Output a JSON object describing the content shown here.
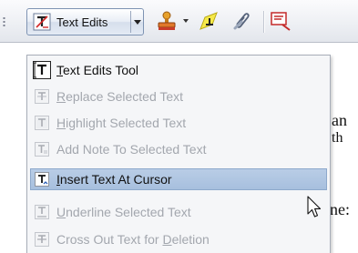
{
  "toolbar": {
    "text_edits_button": {
      "label": "Text Edits",
      "icon": "text-edits-icon"
    },
    "tools": [
      {
        "name": "stamp-tool",
        "icon": "stamp-icon"
      },
      {
        "name": "highlight-tool",
        "icon": "highlighter-icon"
      },
      {
        "name": "attach-tool",
        "icon": "paperclip-icon"
      },
      {
        "name": "comment-tool",
        "icon": "comment-tool-icon"
      }
    ]
  },
  "menu": {
    "items": [
      {
        "pre": "",
        "mnemonic": "T",
        "post": "ext Edits Tool",
        "enabled": true,
        "icon": "text-edits-tool-icon"
      },
      {
        "pre": "",
        "mnemonic": "R",
        "post": "eplace Selected Text",
        "enabled": false,
        "icon": "replace-text-icon"
      },
      {
        "pre": "",
        "mnemonic": "H",
        "post": "ighlight Selected Text",
        "enabled": false,
        "icon": "highlight-text-icon"
      },
      {
        "pre": "Add Note To Selected Text",
        "mnemonic": "",
        "post": "",
        "enabled": false,
        "icon": "add-note-icon"
      },
      {
        "pre": "",
        "mnemonic": "I",
        "post": "nsert Text At Cursor",
        "enabled": true,
        "highlighted": true,
        "icon": "insert-text-icon"
      },
      {
        "pre": "",
        "mnemonic": "U",
        "post": "nderline Selected Text",
        "enabled": false,
        "icon": "underline-text-icon"
      },
      {
        "pre": "Cross Out Text for ",
        "mnemonic": "D",
        "post": "eletion",
        "enabled": false,
        "icon": "cross-out-text-icon"
      }
    ]
  },
  "document": {
    "line1": "an",
    "line2": "th",
    "line3": "ne:"
  },
  "colors": {
    "highlight": "#a7bfde",
    "disabled_text": "#a3a7ae",
    "menu_bg": "#f5f6f8"
  }
}
